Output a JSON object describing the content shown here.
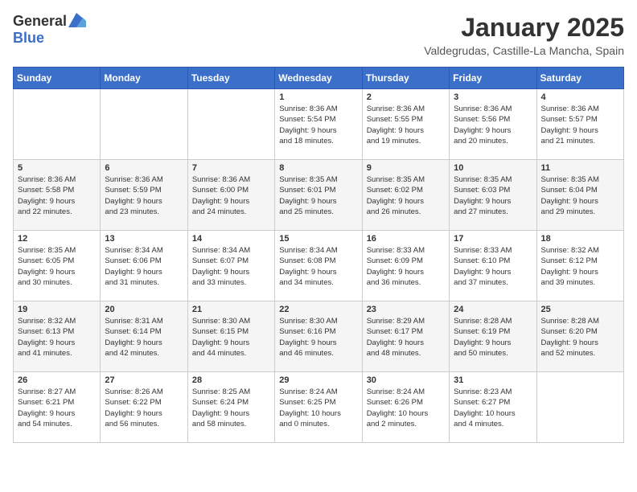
{
  "header": {
    "logo_general": "General",
    "logo_blue": "Blue",
    "month": "January 2025",
    "location": "Valdegrudas, Castille-La Mancha, Spain"
  },
  "weekdays": [
    "Sunday",
    "Monday",
    "Tuesday",
    "Wednesday",
    "Thursday",
    "Friday",
    "Saturday"
  ],
  "weeks": [
    [
      {
        "day": "",
        "info": ""
      },
      {
        "day": "",
        "info": ""
      },
      {
        "day": "",
        "info": ""
      },
      {
        "day": "1",
        "info": "Sunrise: 8:36 AM\nSunset: 5:54 PM\nDaylight: 9 hours\nand 18 minutes."
      },
      {
        "day": "2",
        "info": "Sunrise: 8:36 AM\nSunset: 5:55 PM\nDaylight: 9 hours\nand 19 minutes."
      },
      {
        "day": "3",
        "info": "Sunrise: 8:36 AM\nSunset: 5:56 PM\nDaylight: 9 hours\nand 20 minutes."
      },
      {
        "day": "4",
        "info": "Sunrise: 8:36 AM\nSunset: 5:57 PM\nDaylight: 9 hours\nand 21 minutes."
      }
    ],
    [
      {
        "day": "5",
        "info": "Sunrise: 8:36 AM\nSunset: 5:58 PM\nDaylight: 9 hours\nand 22 minutes."
      },
      {
        "day": "6",
        "info": "Sunrise: 8:36 AM\nSunset: 5:59 PM\nDaylight: 9 hours\nand 23 minutes."
      },
      {
        "day": "7",
        "info": "Sunrise: 8:36 AM\nSunset: 6:00 PM\nDaylight: 9 hours\nand 24 minutes."
      },
      {
        "day": "8",
        "info": "Sunrise: 8:35 AM\nSunset: 6:01 PM\nDaylight: 9 hours\nand 25 minutes."
      },
      {
        "day": "9",
        "info": "Sunrise: 8:35 AM\nSunset: 6:02 PM\nDaylight: 9 hours\nand 26 minutes."
      },
      {
        "day": "10",
        "info": "Sunrise: 8:35 AM\nSunset: 6:03 PM\nDaylight: 9 hours\nand 27 minutes."
      },
      {
        "day": "11",
        "info": "Sunrise: 8:35 AM\nSunset: 6:04 PM\nDaylight: 9 hours\nand 29 minutes."
      }
    ],
    [
      {
        "day": "12",
        "info": "Sunrise: 8:35 AM\nSunset: 6:05 PM\nDaylight: 9 hours\nand 30 minutes."
      },
      {
        "day": "13",
        "info": "Sunrise: 8:34 AM\nSunset: 6:06 PM\nDaylight: 9 hours\nand 31 minutes."
      },
      {
        "day": "14",
        "info": "Sunrise: 8:34 AM\nSunset: 6:07 PM\nDaylight: 9 hours\nand 33 minutes."
      },
      {
        "day": "15",
        "info": "Sunrise: 8:34 AM\nSunset: 6:08 PM\nDaylight: 9 hours\nand 34 minutes."
      },
      {
        "day": "16",
        "info": "Sunrise: 8:33 AM\nSunset: 6:09 PM\nDaylight: 9 hours\nand 36 minutes."
      },
      {
        "day": "17",
        "info": "Sunrise: 8:33 AM\nSunset: 6:10 PM\nDaylight: 9 hours\nand 37 minutes."
      },
      {
        "day": "18",
        "info": "Sunrise: 8:32 AM\nSunset: 6:12 PM\nDaylight: 9 hours\nand 39 minutes."
      }
    ],
    [
      {
        "day": "19",
        "info": "Sunrise: 8:32 AM\nSunset: 6:13 PM\nDaylight: 9 hours\nand 41 minutes."
      },
      {
        "day": "20",
        "info": "Sunrise: 8:31 AM\nSunset: 6:14 PM\nDaylight: 9 hours\nand 42 minutes."
      },
      {
        "day": "21",
        "info": "Sunrise: 8:30 AM\nSunset: 6:15 PM\nDaylight: 9 hours\nand 44 minutes."
      },
      {
        "day": "22",
        "info": "Sunrise: 8:30 AM\nSunset: 6:16 PM\nDaylight: 9 hours\nand 46 minutes."
      },
      {
        "day": "23",
        "info": "Sunrise: 8:29 AM\nSunset: 6:17 PM\nDaylight: 9 hours\nand 48 minutes."
      },
      {
        "day": "24",
        "info": "Sunrise: 8:28 AM\nSunset: 6:19 PM\nDaylight: 9 hours\nand 50 minutes."
      },
      {
        "day": "25",
        "info": "Sunrise: 8:28 AM\nSunset: 6:20 PM\nDaylight: 9 hours\nand 52 minutes."
      }
    ],
    [
      {
        "day": "26",
        "info": "Sunrise: 8:27 AM\nSunset: 6:21 PM\nDaylight: 9 hours\nand 54 minutes."
      },
      {
        "day": "27",
        "info": "Sunrise: 8:26 AM\nSunset: 6:22 PM\nDaylight: 9 hours\nand 56 minutes."
      },
      {
        "day": "28",
        "info": "Sunrise: 8:25 AM\nSunset: 6:24 PM\nDaylight: 9 hours\nand 58 minutes."
      },
      {
        "day": "29",
        "info": "Sunrise: 8:24 AM\nSunset: 6:25 PM\nDaylight: 10 hours\nand 0 minutes."
      },
      {
        "day": "30",
        "info": "Sunrise: 8:24 AM\nSunset: 6:26 PM\nDaylight: 10 hours\nand 2 minutes."
      },
      {
        "day": "31",
        "info": "Sunrise: 8:23 AM\nSunset: 6:27 PM\nDaylight: 10 hours\nand 4 minutes."
      },
      {
        "day": "",
        "info": ""
      }
    ]
  ]
}
